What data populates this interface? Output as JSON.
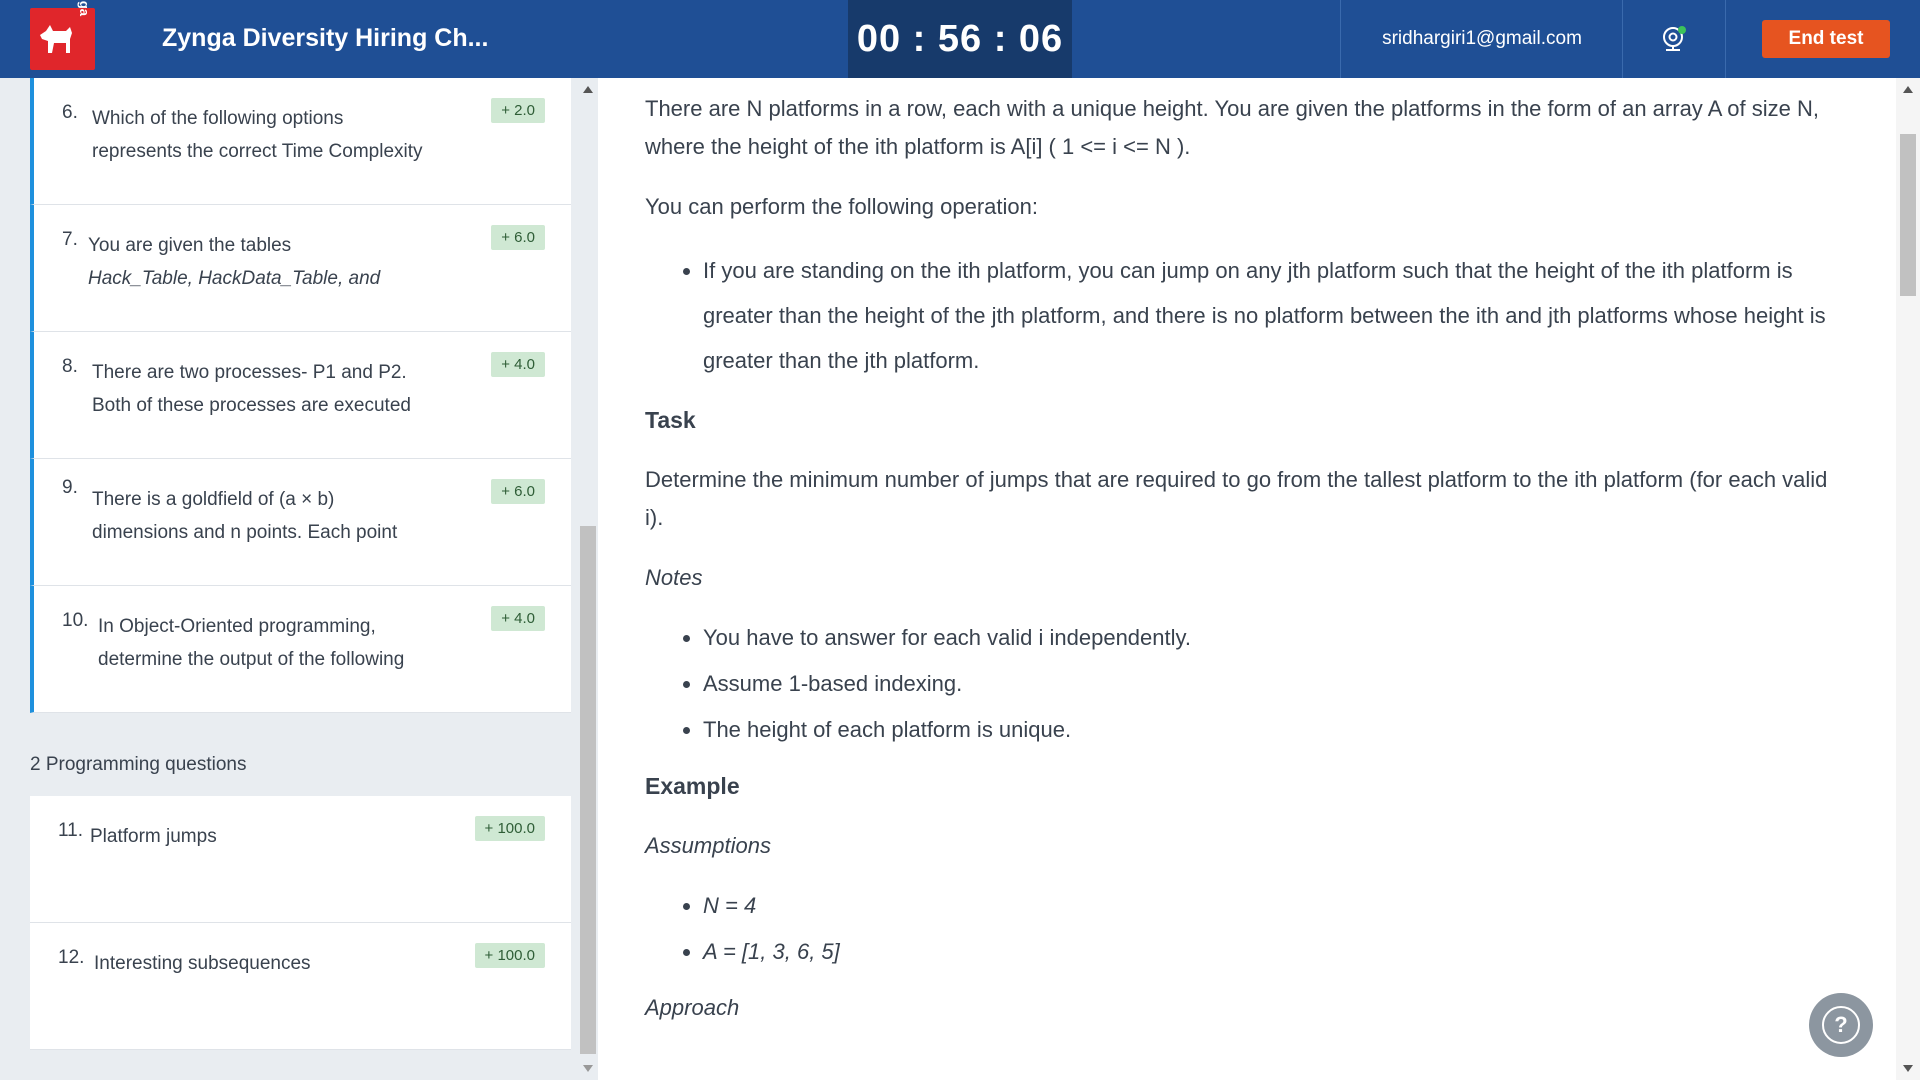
{
  "header": {
    "logo_text": "zynga",
    "test_title": "Zynga Diversity Hiring Ch...",
    "timer": "00 : 56 : 06",
    "email": "sridhargiri1@gmail.com",
    "end_test_label": "End test",
    "webcam_icon": "webcam-icon"
  },
  "questions": [
    {
      "num": "6.",
      "line1": "Which of the following options",
      "line2": "represents the correct Time Complexity",
      "score": "+ 2.0"
    },
    {
      "num": "7.",
      "line1": "You are given the tables",
      "line2": "Hack_Table, HackData_Table, and",
      "score": "+ 6.0"
    },
    {
      "num": "8.",
      "line1": "There are two processes- P1 and P2.",
      "line2": "Both of these processes are executed",
      "score": "+ 4.0"
    },
    {
      "num": "9.",
      "line1": "There is a goldfield of (a × b)",
      "line2": "dimensions and n points. Each point",
      "score": "+ 6.0"
    },
    {
      "num": "10.",
      "line1": "In Object-Oriented programming,",
      "line2": "determine the output of the following",
      "score": "+ 4.0"
    }
  ],
  "programming_section_label": "2 Programming questions",
  "programming_questions": [
    {
      "num": "11.",
      "title": "Platform jumps",
      "score": "+ 100.0"
    },
    {
      "num": "12.",
      "title": "Interesting subsequences",
      "score": "+ 100.0"
    }
  ],
  "problem": {
    "intro": "There are N platforms in a row, each with a unique height. You are given the platforms in the form of an array A of size N, where the height of the ith platform is A[i] ( 1 <= i <= N ).",
    "operation_intro": "You can perform the following operation:",
    "operation_rule": "If you are standing on the ith platform, you can jump on any jth platform such that the height of the ith platform is greater than the height of the jth platform, and there is no platform between the ith and jth platforms whose height is greater than the jth platform.",
    "task_heading": "Task",
    "task_text": "Determine the minimum number of jumps that are required to go from the tallest platform to the ith platform (for each valid i).",
    "notes_heading": "Notes",
    "notes": [
      "You have to answer for each valid i independently.",
      "Assume 1-based indexing.",
      "The height of each platform is unique."
    ],
    "example_heading": "Example",
    "assumptions_heading": "Assumptions",
    "assumptions": [
      "N = 4",
      "A  = [1, 3, 6, 5]"
    ],
    "approach_heading": "Approach"
  },
  "help_label": "?"
}
